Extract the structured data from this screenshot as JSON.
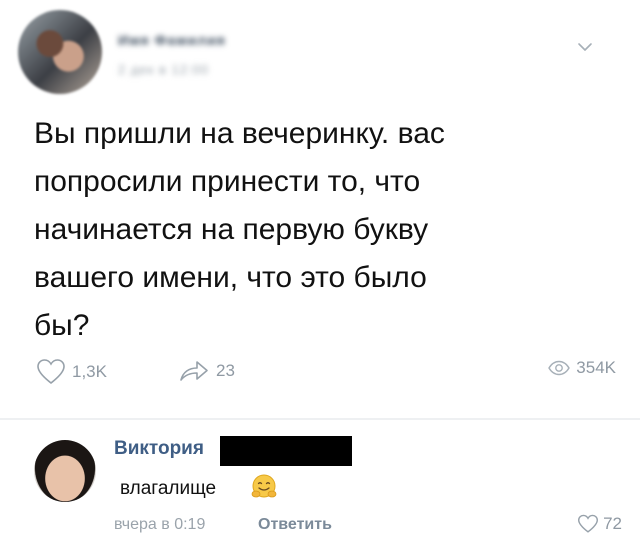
{
  "post": {
    "author": "Имя Фамилия",
    "date": "2 дек в 12:00",
    "text": "Вы пришли на вечеринку. вас\nпопросили принести то, что\nначинается на первую букву\nвашего имени, что это было\nбы?",
    "likes": "1,3K",
    "shares": "23",
    "views": "354K"
  },
  "comment": {
    "author": "Виктория",
    "text": "влагалище",
    "time": "вчера в 0:19",
    "reply_label": "Ответить",
    "likes": "72"
  },
  "icons": {
    "menu": "chevron-down-icon",
    "like": "heart-icon",
    "share": "share-arrow-icon",
    "views": "eye-icon",
    "emoji": "hugging-face-emoji"
  },
  "colors": {
    "accent_name": "#3f5e85",
    "muted": "#8f99a3"
  }
}
